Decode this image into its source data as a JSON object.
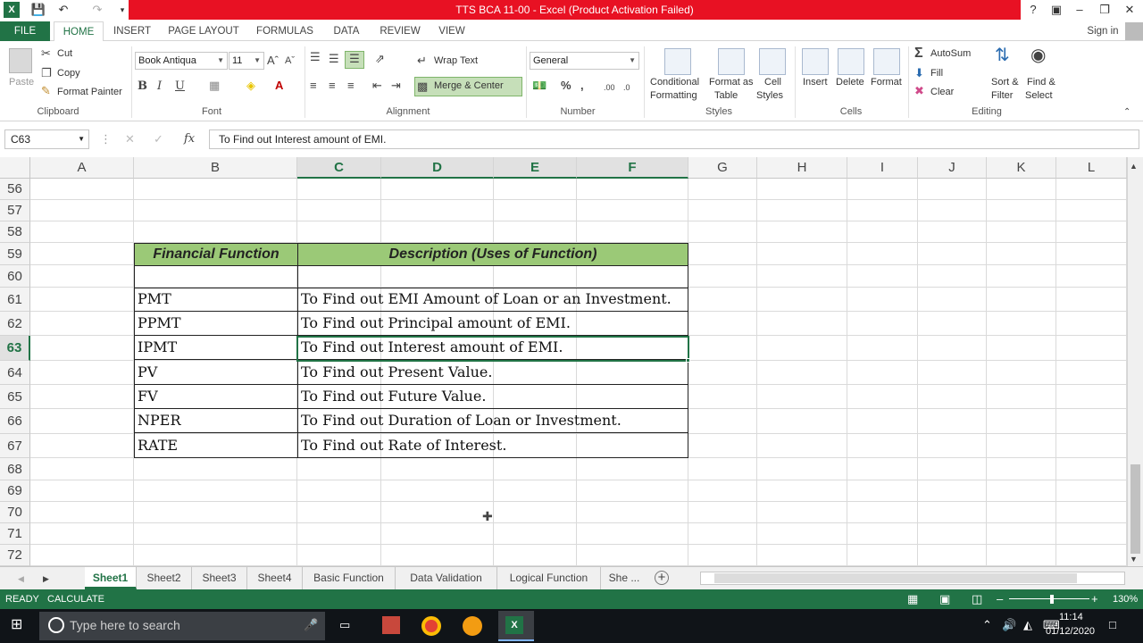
{
  "title": {
    "text": "TTS BCA 11-00 -  Excel (Product Activation Failed)",
    "help": "?",
    "signin": "Sign in"
  },
  "tabs": [
    "FILE",
    "HOME",
    "INSERT",
    "PAGE LAYOUT",
    "FORMULAS",
    "DATA",
    "REVIEW",
    "VIEW"
  ],
  "ribbon": {
    "clipboard": {
      "paste": "Paste",
      "cut": "Cut",
      "copy": "Copy",
      "format_painter": "Format Painter",
      "label": "Clipboard"
    },
    "font": {
      "name": "Book Antiqua",
      "size": "11",
      "label": "Font"
    },
    "alignment": {
      "wrap": "Wrap Text",
      "merge": "Merge & Center",
      "label": "Alignment"
    },
    "number": {
      "format": "General",
      "label": "Number"
    },
    "styles": {
      "conditional": "Conditional",
      "conditional2": "Formatting",
      "format_as": "Format as",
      "format_as2": "Table",
      "cell": "Cell",
      "cell2": "Styles",
      "label": "Styles"
    },
    "cells": {
      "insert": "Insert",
      "delete": "Delete",
      "format": "Format",
      "label": "Cells"
    },
    "editing": {
      "autosum": "AutoSum",
      "fill": "Fill",
      "clear": "Clear",
      "sort": "Sort &",
      "sort2": "Filter",
      "find": "Find &",
      "find2": "Select",
      "label": "Editing"
    }
  },
  "formula_bar": {
    "name_box": "C63",
    "fx": "fx",
    "content": "To Find out Interest amount of EMI."
  },
  "columns": [
    "A",
    "B",
    "C",
    "D",
    "E",
    "F",
    "G",
    "H",
    "I",
    "J",
    "K",
    "L"
  ],
  "rows": [
    "56",
    "57",
    "58",
    "59",
    "60",
    "61",
    "62",
    "63",
    "64",
    "65",
    "66",
    "67",
    "68",
    "69",
    "70",
    "71",
    "72"
  ],
  "table": {
    "header_func": "Financial Function",
    "header_desc": "Description (Uses of Function)",
    "rows": [
      {
        "func": "PMT",
        "desc": "To Find out EMI Amount of Loan or an Investment."
      },
      {
        "func": "PPMT",
        "desc": "To Find out Principal amount of EMI."
      },
      {
        "func": "IPMT",
        "desc": "To Find out Interest amount of EMI."
      },
      {
        "func": "PV",
        "desc": "To Find out Present Value."
      },
      {
        "func": "FV",
        "desc": "To Find out Future Value."
      },
      {
        "func": "NPER",
        "desc": "To Find out Duration of Loan or Investment."
      },
      {
        "func": "RATE",
        "desc": "To Find out Rate of Interest."
      }
    ]
  },
  "sheet_tabs": [
    "Sheet1",
    "Sheet2",
    "Sheet3",
    "Sheet4",
    "Basic Function",
    "Data Validation",
    "Logical Function",
    "She ..."
  ],
  "status": {
    "ready": "READY",
    "calculate": "CALCULATE",
    "zoom": "130%"
  },
  "taskbar": {
    "search": "Type here to search",
    "time": "11:14",
    "date": "01/12/2020"
  }
}
